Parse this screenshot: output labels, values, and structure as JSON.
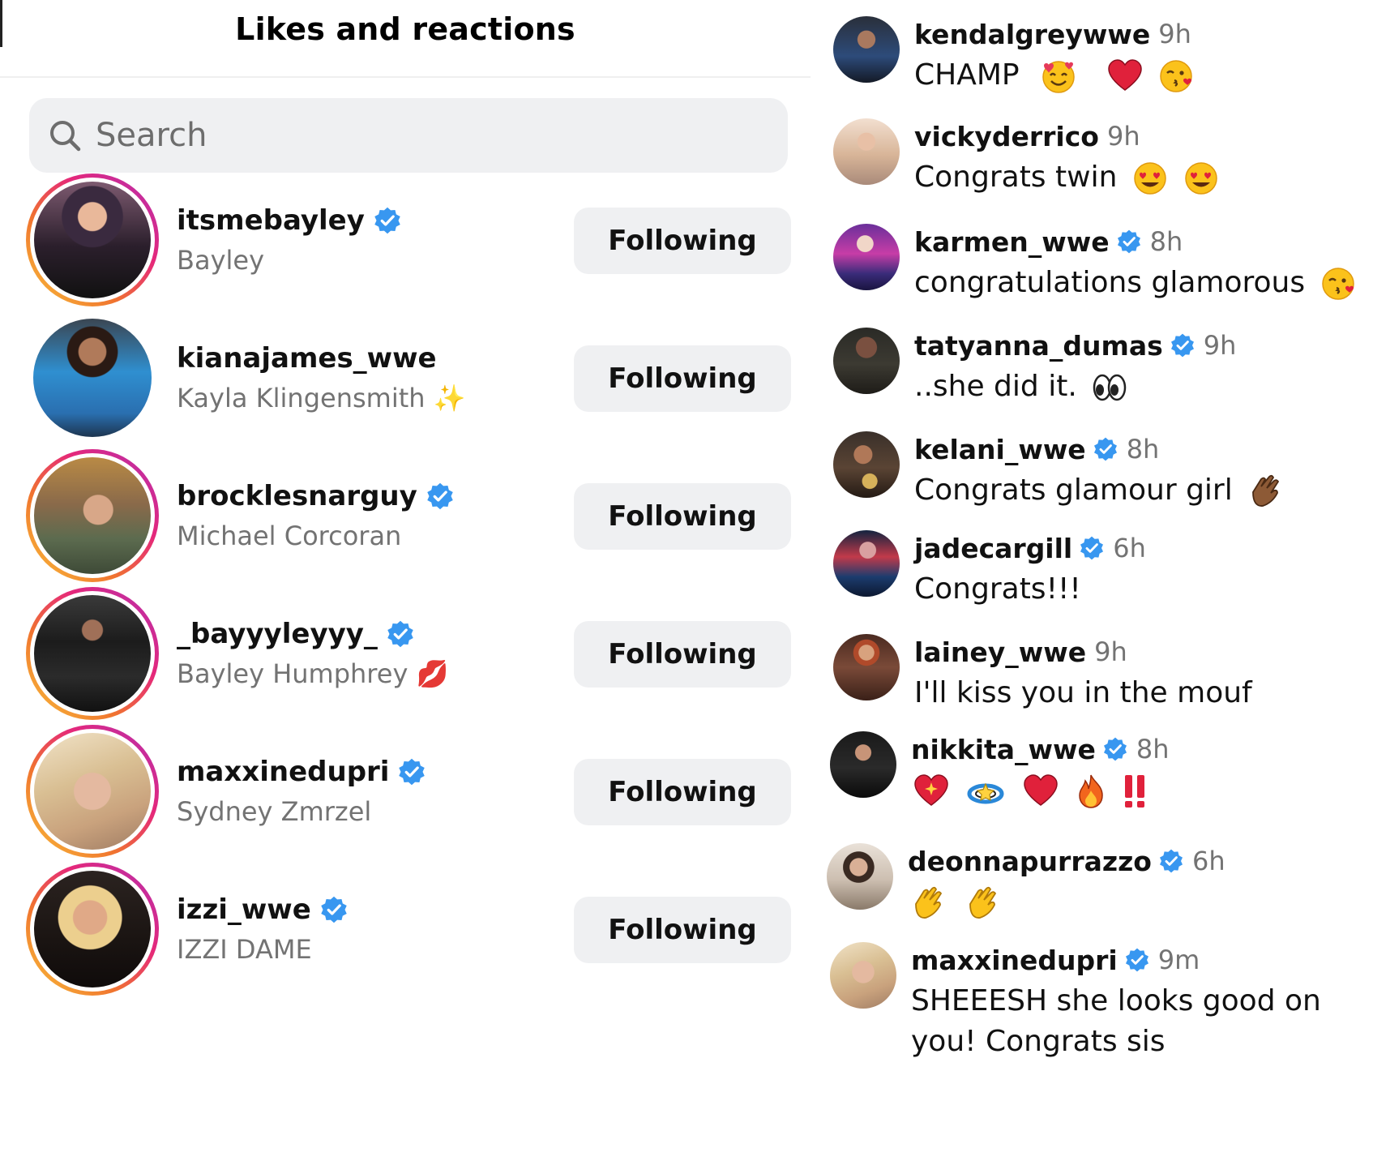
{
  "header": {
    "title": "Likes and reactions"
  },
  "search": {
    "placeholder": "Search",
    "icon": "search-icon"
  },
  "likes": [
    {
      "username": "itsmebayley",
      "full_name": "Bayley",
      "verified": true,
      "story_ring": true,
      "button": "Following"
    },
    {
      "username": "kianajames_wwe",
      "full_name": "Kayla Klingensmith ✨",
      "verified": false,
      "story_ring": false,
      "button": "Following"
    },
    {
      "username": "brocklesnarguy",
      "full_name": "Michael Corcoran",
      "verified": true,
      "story_ring": true,
      "button": "Following"
    },
    {
      "username": "_bayyyleyyy_",
      "full_name": "Bayley Humphrey 💋",
      "verified": true,
      "story_ring": true,
      "button": "Following"
    },
    {
      "username": "maxxinedupri",
      "full_name": "Sydney Zmrzel",
      "verified": true,
      "story_ring": true,
      "button": "Following"
    },
    {
      "username": "izzi_wwe",
      "full_name": "IZZI DAME",
      "verified": true,
      "story_ring": true,
      "button": "Following"
    }
  ],
  "comments": [
    {
      "username": "kendalgreywwe",
      "verified": false,
      "time": "9h",
      "text": "CHAMP",
      "emojis": [
        "smiling-hearts",
        "heart",
        "kiss"
      ]
    },
    {
      "username": "vickyderrico",
      "verified": false,
      "time": "9h",
      "text": "Congrats twin",
      "emojis": [
        "heart-eyes",
        "heart-eyes"
      ]
    },
    {
      "username": "karmen_wwe",
      "verified": true,
      "time": "8h",
      "text": "congratulations glamorous",
      "emojis": [
        "kiss"
      ]
    },
    {
      "username": "tatyanna_dumas",
      "verified": true,
      "time": "9h",
      "text": "..she did it.",
      "emojis": [
        "eyes"
      ]
    },
    {
      "username": "kelani_wwe",
      "verified": true,
      "time": "8h",
      "text": "Congrats glamour girl",
      "emojis": [
        "clap-dark"
      ]
    },
    {
      "username": "jadecargill",
      "verified": true,
      "time": "6h",
      "text": "Congrats!!!",
      "emojis": []
    },
    {
      "username": "lainey_wwe",
      "verified": false,
      "time": "9h",
      "text": "I'll kiss you in the mouf",
      "emojis": []
    },
    {
      "username": "nikkita_wwe",
      "verified": true,
      "time": "8h",
      "text": "",
      "emojis": [
        "sparkling-heart",
        "dizzy",
        "heart",
        "fire",
        "double-exclamation"
      ]
    },
    {
      "username": "deonnapurrazzo",
      "verified": true,
      "time": "6h",
      "text": "",
      "emojis": [
        "clap",
        "clap"
      ]
    },
    {
      "username": "maxxinedupri",
      "verified": true,
      "time": "9m",
      "text": "SHEEESH she looks good on you! Congrats sis",
      "emojis": []
    }
  ],
  "colors": {
    "verified_blue": "#3897f0",
    "muted_text": "#737373",
    "button_bg": "#eff0f2",
    "ring_gradient": [
      "#f9c33a",
      "#f0742f",
      "#e5287a",
      "#b22fb3"
    ]
  }
}
